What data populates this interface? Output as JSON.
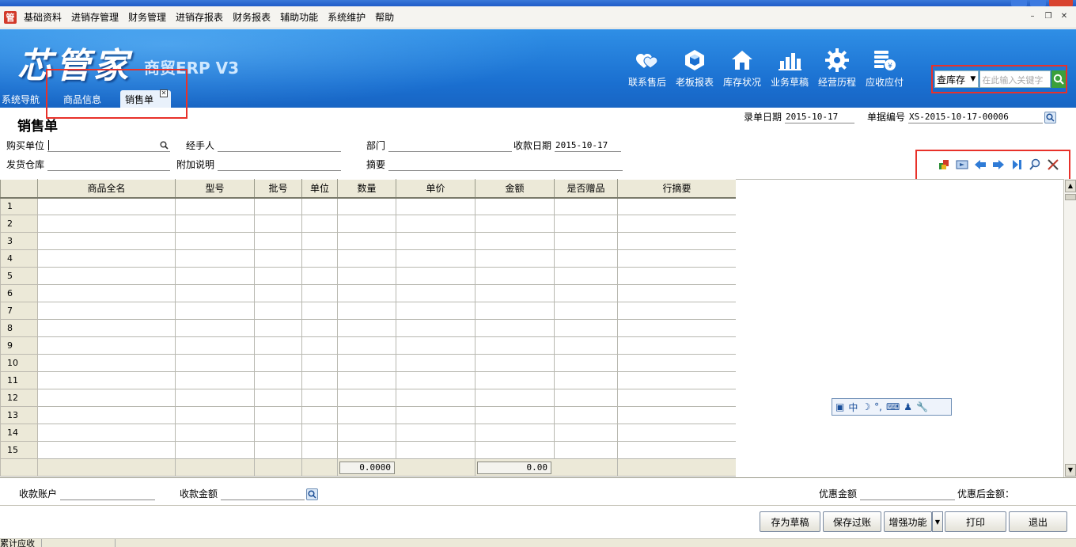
{
  "menu": {
    "items": [
      "基础资料",
      "进销存管理",
      "财务管理",
      "进销存报表",
      "财务报表",
      "辅助功能",
      "系统维护",
      "帮助"
    ],
    "app_icon_char": "管"
  },
  "brand": {
    "logo": "芯管家",
    "subtitle": "商贸ERP V3"
  },
  "quick_buttons": [
    {
      "label": "联系售后",
      "icon": "handshake-heart-icon"
    },
    {
      "label": "老板报表",
      "icon": "hexagon-box-icon"
    },
    {
      "label": "库存状况",
      "icon": "house-icon"
    },
    {
      "label": "业务草稿",
      "icon": "bar-chart-icon"
    },
    {
      "label": "经营历程",
      "icon": "gear-icon"
    },
    {
      "label": "应收应付",
      "icon": "ledger-coin-icon"
    }
  ],
  "search": {
    "scope": "查库存",
    "placeholder": "在此输入关键字"
  },
  "tabs": [
    {
      "label": "系统导航"
    },
    {
      "label": "商品信息"
    },
    {
      "label": "销售单",
      "active": true
    }
  ],
  "form": {
    "title": "销售单",
    "record_date_label": "录单日期",
    "record_date": "2015-10-17",
    "doc_no_label": "单据编号",
    "doc_no": "XS-2015-10-17-00006",
    "buyer_label": "购买单位",
    "handler_label": "经手人",
    "dept_label": "部门",
    "receive_date_label": "收款日期",
    "receive_date": "2015-10-17",
    "warehouse_label": "发货仓库",
    "note_label": "附加说明",
    "summary_label": "摘要"
  },
  "grid": {
    "columns": [
      "商品全名",
      "型号",
      "批号",
      "单位",
      "数量",
      "单价",
      "金额",
      "是否赠品",
      "行摘要"
    ],
    "row_numbers": [
      "1",
      "2",
      "3",
      "4",
      "5",
      "6",
      "7",
      "8",
      "9",
      "10",
      "11",
      "12",
      "13",
      "14",
      "15"
    ],
    "qty_total": "0.0000",
    "amount_total": "0.00"
  },
  "ime": {
    "lang": "中"
  },
  "footer": {
    "account_label": "收款账户",
    "amount_label": "收款金额",
    "discount_label": "优惠金额",
    "after_discount_label": "优惠后金额：",
    "buttons": {
      "draft": "存为草稿",
      "post": "保存过账",
      "enhance": "增强功能",
      "print": "打印",
      "exit": "退出"
    }
  },
  "status": {
    "cumulative_label": "累计应收"
  }
}
